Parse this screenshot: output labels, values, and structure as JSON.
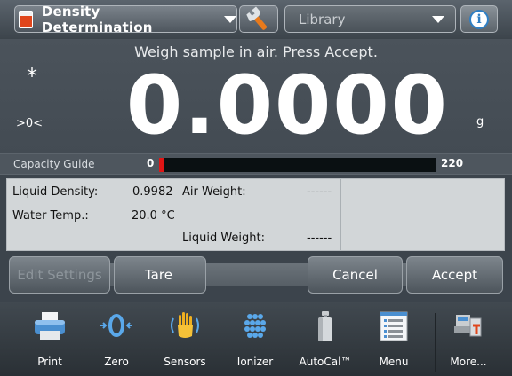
{
  "header": {
    "app_name": "Density Determination",
    "library_label": "Library",
    "info_glyph": "i"
  },
  "display": {
    "instruction": "Weigh sample in air. Press Accept.",
    "stable_indicator": "*",
    "zero_indicator": ">0<",
    "weight": "0.0000",
    "unit": "g"
  },
  "capacity_guide": {
    "label": "Capacity Guide",
    "min": "0",
    "max": "220",
    "fill_fraction": 0.02,
    "fill_color": "#e01515"
  },
  "data": {
    "liquid_density_label": "Liquid Density:",
    "liquid_density_value": "0.9982",
    "water_temp_label": "Water Temp.:",
    "water_temp_value": "20.0 °C",
    "air_weight_label": "Air Weight:",
    "air_weight_value": "------",
    "liquid_weight_label": "Liquid Weight:",
    "liquid_weight_value": "------"
  },
  "softkeys": {
    "edit_settings": "Edit Settings",
    "tare": "Tare",
    "cancel": "Cancel",
    "accept": "Accept"
  },
  "toolbar": {
    "items": [
      {
        "label": "Print",
        "icon": "printer-icon"
      },
      {
        "label": "Zero",
        "icon": "zero-icon"
      },
      {
        "label": "Sensors",
        "icon": "hand-sensor-icon"
      },
      {
        "label": "Ionizer",
        "icon": "ionizer-icon"
      },
      {
        "label": "AutoCal™",
        "icon": "calibration-weight-icon"
      },
      {
        "label": "Menu",
        "icon": "menu-list-icon"
      },
      {
        "label": "More...",
        "icon": "more-icon"
      }
    ]
  },
  "colors": {
    "accent_blue": "#2f7fc4",
    "app_icon_red": "#e0461c"
  }
}
